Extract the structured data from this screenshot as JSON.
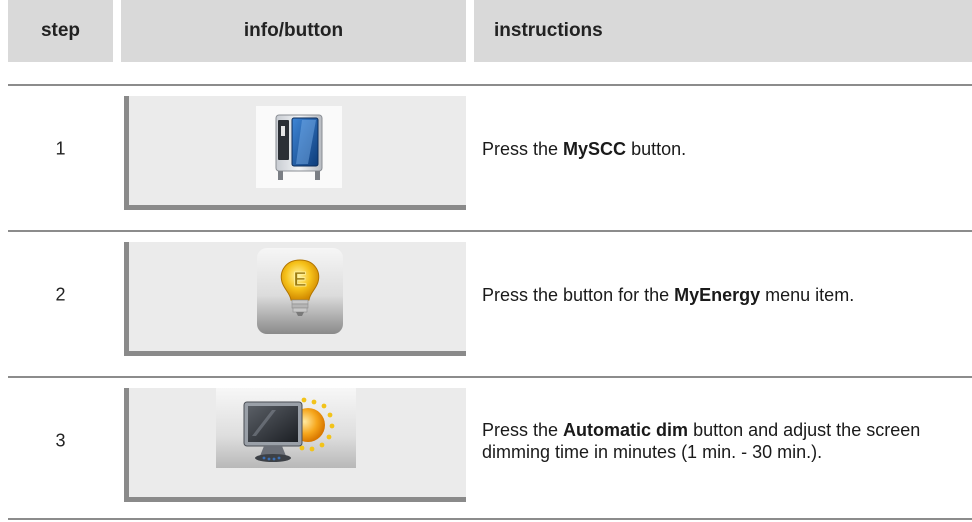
{
  "header": {
    "step": "step",
    "info": "info/button",
    "instructions": "instructions"
  },
  "rows": [
    {
      "step": "1",
      "icon": "combi-oven-icon",
      "text_pre": "Press the ",
      "text_bold": "MySCC",
      "text_post": " button."
    },
    {
      "step": "2",
      "icon": "energy-bulb-icon",
      "icon_letter": "E",
      "text_pre": "Press the button for the ",
      "text_bold": "MyEnergy",
      "text_post": " menu item."
    },
    {
      "step": "3",
      "icon": "monitor-sun-icon",
      "text_pre": "Press the ",
      "text_bold": "Automatic dim",
      "text_post": " button and adjust the screen dimming time in minutes (1 min. - 30 min.)."
    }
  ]
}
